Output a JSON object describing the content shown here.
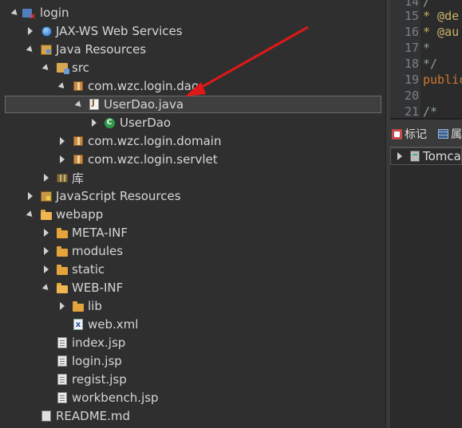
{
  "tree": {
    "root": {
      "label": "login",
      "icon": "project-icon"
    },
    "jaxws": {
      "label": "JAX-WS Web Services",
      "icon": "globe-icon"
    },
    "java_resources": {
      "label": "Java Resources",
      "icon": "java-resources-icon"
    },
    "src": {
      "label": "src",
      "icon": "source-folder-icon"
    },
    "pkg_dao": {
      "label": "com.wzc.login.dao",
      "icon": "package-icon"
    },
    "file_userdao": {
      "label": "UserDao.java",
      "icon": "java-file-icon",
      "selected": true
    },
    "class_userdao": {
      "label": "UserDao",
      "icon": "class-icon"
    },
    "pkg_domain": {
      "label": "com.wzc.login.domain",
      "icon": "package-icon"
    },
    "pkg_servlet": {
      "label": "com.wzc.login.servlet",
      "icon": "package-icon"
    },
    "lib_ku": {
      "label": "库",
      "icon": "library-icon"
    },
    "js_resources": {
      "label": "JavaScript Resources",
      "icon": "javascript-resources-icon"
    },
    "webapp": {
      "label": "webapp",
      "icon": "folder-icon"
    },
    "meta_inf": {
      "label": "META-INF",
      "icon": "folder-icon"
    },
    "modules": {
      "label": "modules",
      "icon": "folder-icon"
    },
    "static": {
      "label": "static",
      "icon": "folder-icon"
    },
    "web_inf": {
      "label": "WEB-INF",
      "icon": "folder-icon"
    },
    "lib": {
      "label": "lib",
      "icon": "folder-icon"
    },
    "web_xml": {
      "label": "web.xml",
      "icon": "xml-file-icon"
    },
    "index_jsp": {
      "label": "index.jsp",
      "icon": "jsp-file-icon"
    },
    "login_jsp": {
      "label": "login.jsp",
      "icon": "jsp-file-icon"
    },
    "regist_jsp": {
      "label": "regist.jsp",
      "icon": "jsp-file-icon"
    },
    "workbench_jsp": {
      "label": "workbench.jsp",
      "icon": "jsp-file-icon"
    },
    "readme": {
      "label": "README.md",
      "icon": "markdown-file-icon"
    }
  },
  "editor": {
    "lines": [
      {
        "num": "14",
        "text": "/"
      },
      {
        "num": "15",
        "text": " * @de"
      },
      {
        "num": "16",
        "text": " * @au"
      },
      {
        "num": "17",
        "text": " *"
      },
      {
        "num": "18",
        "text": " */"
      },
      {
        "num": "19",
        "text": "public"
      },
      {
        "num": "20",
        "text": ""
      },
      {
        "num": "21",
        "text": "   /*"
      }
    ]
  },
  "panel": {
    "tab_markers": "标记",
    "tab_second": "属",
    "server_label": "Tomca"
  },
  "annotation": {
    "arrow_color": "#e01818"
  }
}
